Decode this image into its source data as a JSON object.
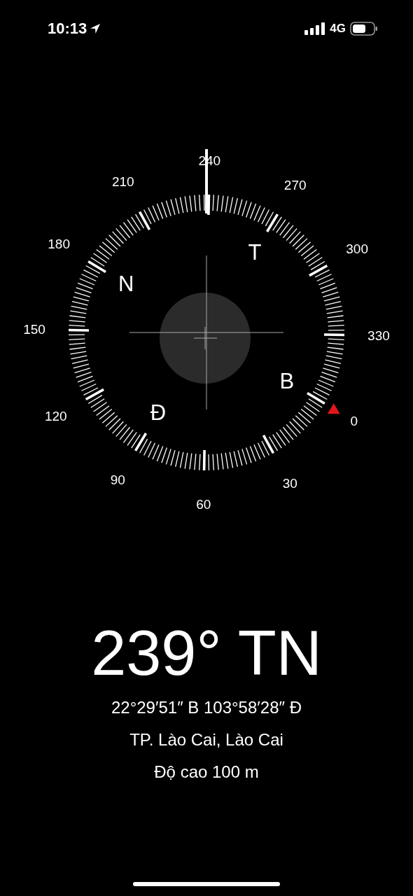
{
  "status_bar": {
    "time": "10:13",
    "network": "4G"
  },
  "compass": {
    "degree_labels": [
      "0",
      "30",
      "60",
      "90",
      "120",
      "150",
      "180",
      "210",
      "240",
      "270",
      "300",
      "330"
    ],
    "cardinals": [
      "B",
      "Đ",
      "N",
      "T"
    ]
  },
  "reading": {
    "heading": "239° TN",
    "coordinates": "22°29′51″ B  103°58′28″ Đ",
    "place": "TP. Lào Cai, Lào Cai",
    "altitude": "Độ cao 100 m"
  }
}
